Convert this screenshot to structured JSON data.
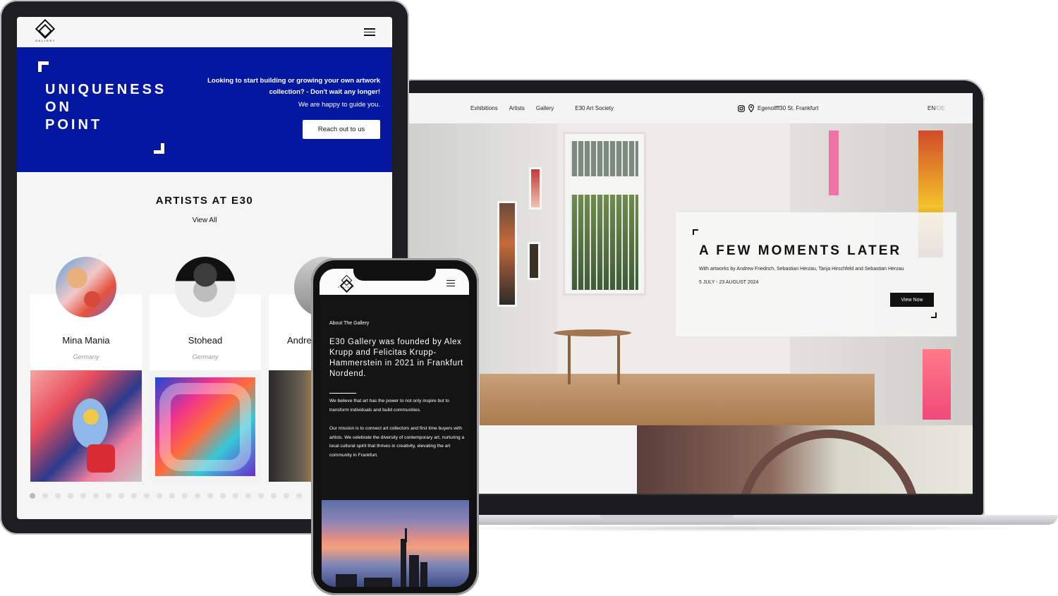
{
  "laptop": {
    "nav": {
      "links": [
        "Exhibitions",
        "Artists",
        "Gallery",
        "E30 Art Society"
      ],
      "address": "Egenolfff30 St. Frankfurt",
      "lang_active": "EN",
      "lang_sep": "/",
      "lang_other": "DE"
    },
    "hero_card": {
      "title": "A FEW MOMENTS LATER",
      "subtitle": "With artworks by Andrew Friedrich, Sebastian Herzau, Tanja Hirschfeld and Sebastian Herzau",
      "date": "5 JULY - 23 AUGUST 2024",
      "button": "View Now"
    }
  },
  "tablet": {
    "logo_text": "GALLERY",
    "hero": {
      "title_lines": [
        "UNIQUENESS",
        "ON",
        "POINT"
      ],
      "line1": "Looking to start building or growing your own artwork",
      "line2": "collection? - Don't wait any longer!",
      "line3": "We are happy to guide you.",
      "button": "Reach out to us"
    },
    "artists_section": {
      "title": "ARTISTS AT E30",
      "view_all": "View All",
      "artists": [
        {
          "name": "Mina Mania",
          "country": "Germany"
        },
        {
          "name": "Stohead",
          "country": "Germany"
        },
        {
          "name": "Andre",
          "country": ""
        }
      ],
      "dot_count": 22,
      "active_dot": 0
    }
  },
  "phone": {
    "logo_text": "GALLERY",
    "label": "About The Gallery",
    "heading": "E30 Gallery was founded by Alex Krupp and Felicitas Krupp-Hammerstein in 2021 in Frankfurt Nordend.",
    "para1": "We believe that art has the power to not only inspire but to transform individuals and build communities.",
    "para2": "Our mission is to connect art collectors and first time buyers with artists. We celebrate the diversity of contemporary art, nurturing a local cultural spirit that thrives in creativity, elevating the art community in Frankfurt."
  },
  "colors": {
    "brand_blue": "#0317a0",
    "dark": "#141414",
    "light_bg": "#f5f5f5"
  }
}
